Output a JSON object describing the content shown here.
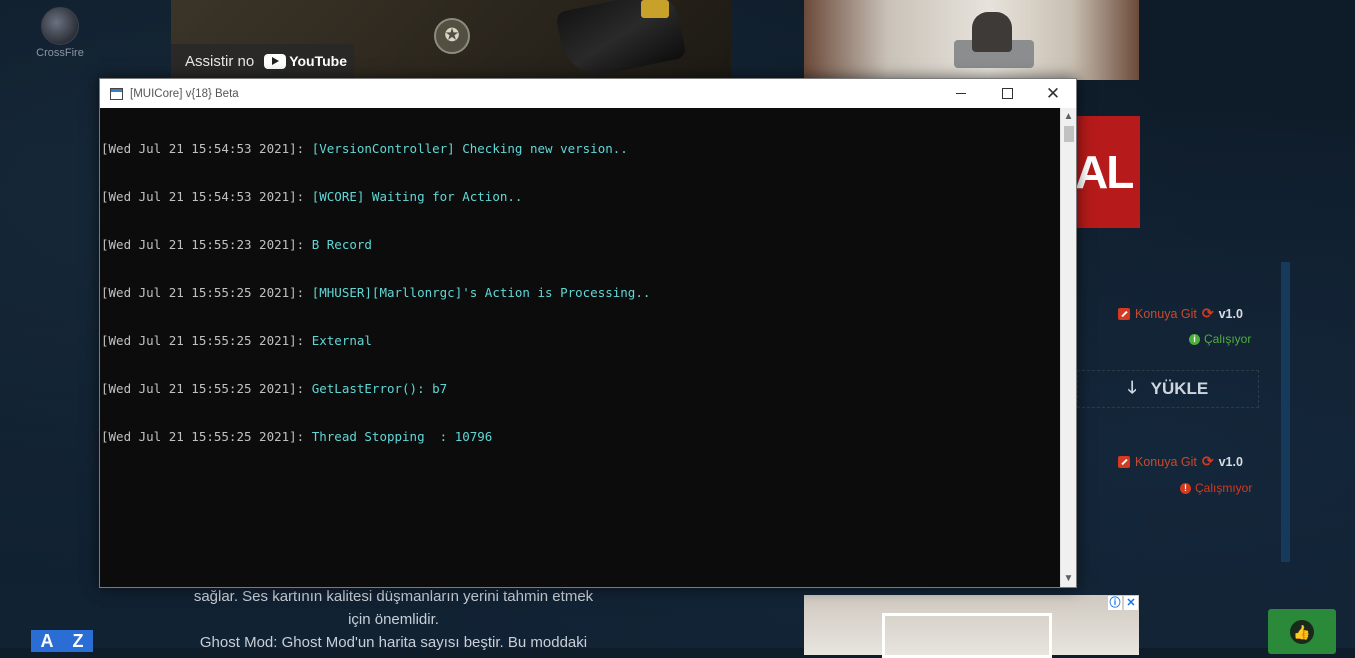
{
  "sidebar": {
    "app_label": "CrossFire",
    "az_label_a": "A",
    "az_label_z": "Z"
  },
  "video": {
    "watch_on": "Assistir no",
    "brand": "YouTube"
  },
  "banner": {
    "text": "AL"
  },
  "downloads": [
    {
      "link": "Konuya Git",
      "version": "v1.0",
      "status": "Çalışıyor"
    },
    {
      "link": "Konuya Git",
      "version": "v1.0",
      "status": "Çalışmıyor"
    }
  ],
  "yukle_label": "YÜKLE",
  "article": {
    "line1": "sağlar. Ses kartının kalitesi düşmanların yerini tahmin etmek",
    "line2": "için önemlidir.",
    "line3": "Ghost Mod: Ghost Mod'un harita sayısı beştir. Bu moddaki"
  },
  "console": {
    "title": "[MUICore] v{18} Beta",
    "lines": [
      {
        "ts": "[Wed Jul 21 15:54:53 2021]: ",
        "msg": "[VersionController] Checking new version.."
      },
      {
        "ts": "[Wed Jul 21 15:54:53 2021]: ",
        "msg": "[WCORE] Waiting for Action.."
      },
      {
        "ts": "[Wed Jul 21 15:55:23 2021]: ",
        "msg": "B Record"
      },
      {
        "ts": "[Wed Jul 21 15:55:25 2021]: ",
        "msg": "[MHUSER][Marllonrgc]'s Action is Processing.."
      },
      {
        "ts": "[Wed Jul 21 15:55:25 2021]: ",
        "msg": "External"
      },
      {
        "ts": "[Wed Jul 21 15:55:25 2021]: ",
        "msg": "GetLastError(): b7"
      },
      {
        "ts": "[Wed Jul 21 15:55:25 2021]: ",
        "msg": "Thread Stopping  : 10796"
      }
    ]
  },
  "colors": {
    "timestamp": "#c0c0c0",
    "message": "#61d6d6",
    "console_bg": "#0c0c0c",
    "link_red": "#c94a2c",
    "ok_green": "#4fae3e"
  }
}
